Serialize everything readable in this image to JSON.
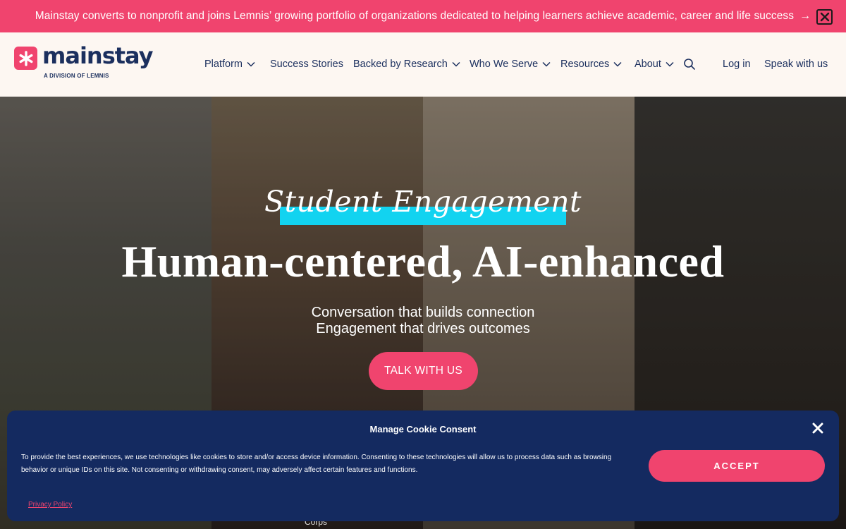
{
  "banner": {
    "text": "Mainstay converts to nonprofit and joins Lemnis’ growing portfolio of organizations dedicated to helping learners achieve academic, career and life success",
    "arrow": "→",
    "close_icon": "close-icon"
  },
  "header": {
    "logo_word": "mainstay",
    "logo_sub": "A DIVISION OF LEMNIS",
    "nav": [
      {
        "label": "Platform",
        "has_dropdown": true
      },
      {
        "label": "Success Stories",
        "has_dropdown": false
      },
      {
        "label": "Backed by Research",
        "has_dropdown": true
      },
      {
        "label": "Who We Serve",
        "has_dropdown": true
      },
      {
        "label": "Resources",
        "has_dropdown": true
      },
      {
        "label": "About",
        "has_dropdown": true
      }
    ],
    "login": "Log in",
    "speak": "Speak with us"
  },
  "hero": {
    "eyebrow": "Student Engagement",
    "headline": "Human-centered, AI-enhanced",
    "sub1": "Conversation that builds connection",
    "sub2": "Engagement that drives outcomes",
    "cta": "TALK WITH US",
    "partners": [
      "Corps"
    ]
  },
  "cookie": {
    "title": "Manage Cookie Consent",
    "text": "To provide the best experiences, we use technologies like cookies to store and/or access device information. Consenting to these technologies will allow us to process data such as browsing behavior or unique IDs on this site. Not consenting or withdrawing consent, may adversely affect certain features and functions.",
    "accept": "ACCEPT",
    "privacy": "Privacy Policy"
  },
  "colors": {
    "accent": "#f0446e",
    "navy": "#1b2f5e",
    "highlight": "#12d3f0",
    "cookie_bg": "#142a60"
  }
}
